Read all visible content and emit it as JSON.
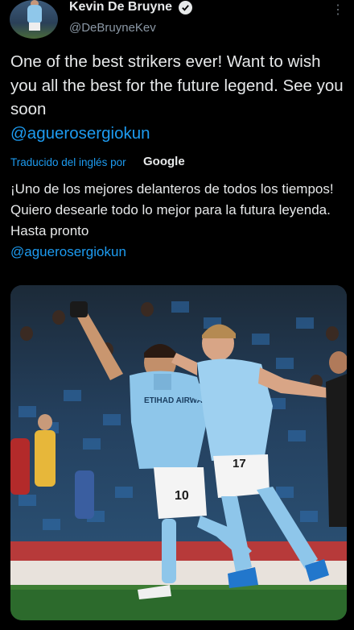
{
  "author": {
    "display_name": "Kevin De Bruyne",
    "handle": "@DeBruyneKev",
    "verified": true,
    "avatar_icon": "avatar"
  },
  "tweet": {
    "text": "One of the best strikers ever! Want to wish you all the best for the future legend. See you soon",
    "mention": "@aguerosergiokun"
  },
  "translation": {
    "label": "Traducido del inglés por",
    "provider": "Google",
    "text": "¡Uno de los mejores delanteros de todos los tiempos! Quiero desearle todo lo mejor para la futura leyenda. Hasta pronto",
    "mention": "@aguerosergiokun"
  },
  "menu": {
    "icon": "more-vertical-icon",
    "glyph": "⋮"
  },
  "colors": {
    "accent": "#1d9bf0",
    "background": "#000000",
    "text": "#e7e9ea",
    "muted": "#8b98a5"
  },
  "photo": {
    "jersey_numbers": [
      "10",
      "17"
    ],
    "sponsor": "ETIHAD AIRWAYS"
  }
}
